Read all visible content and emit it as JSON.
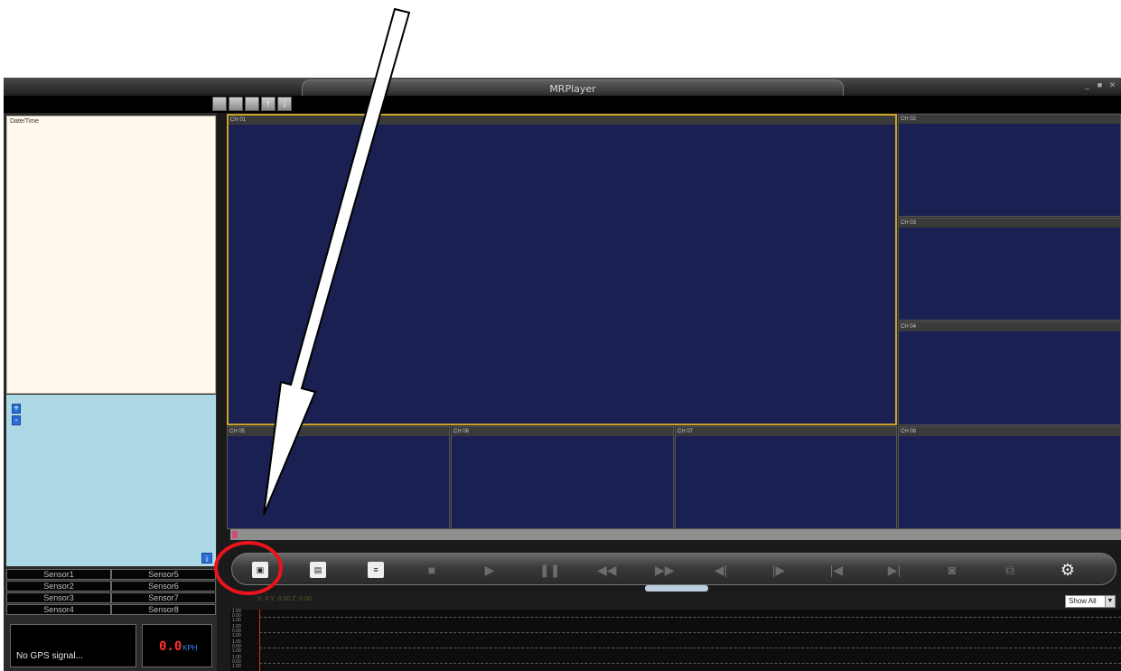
{
  "window": {
    "title": "MRPlayer"
  },
  "toolbar": {
    "icons": [
      "layout-1-icon",
      "layout-2-icon",
      "layout-3-icon",
      "upload-icon",
      "download-icon"
    ]
  },
  "left_panel": {
    "datetime_header": "Date/Time",
    "map_zoom_in": "+",
    "map_zoom_out": "-",
    "map_info": "i",
    "sensors": [
      "Sensor1",
      "Sensor5",
      "Sensor2",
      "Sensor6",
      "Sensor3",
      "Sensor7",
      "Sensor4",
      "Sensor8"
    ],
    "gps_status": "No GPS signal...",
    "speed_value": "0.0",
    "speed_unit": "KPH"
  },
  "channels": [
    "CH 01",
    "CH 02",
    "CH 03",
    "CH 04",
    "CH 05",
    "CH 06",
    "CH 07",
    "CH 08"
  ],
  "controls": {
    "buttons": [
      "open-file",
      "sd-card",
      "ssd",
      "stop",
      "play",
      "pause",
      "rewind",
      "fast-forward",
      "step-back",
      "step-forward",
      "previous",
      "next",
      "snapshot",
      "export",
      "settings"
    ]
  },
  "timeline": {
    "axis_label": "X: 0  Y: 0.00  Z: 0.00",
    "filter": "Show All",
    "row_values": [
      "1.00",
      "0.00",
      "1.00"
    ]
  },
  "colors": {
    "video_bg": "#1b2052",
    "selected_border": "#c9a227",
    "annotation": "#e8141c"
  }
}
